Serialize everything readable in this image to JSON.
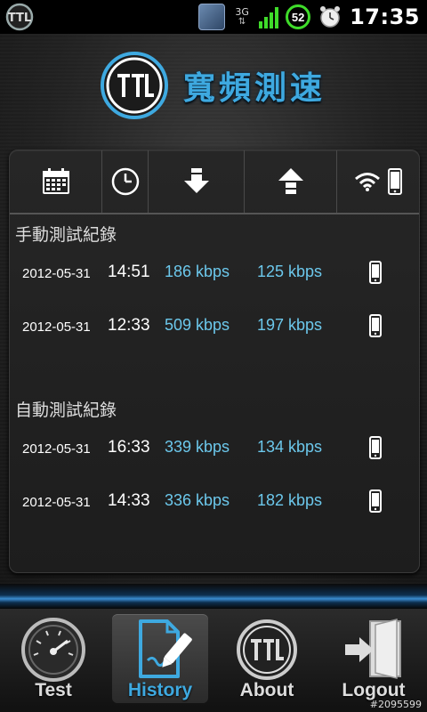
{
  "status_bar": {
    "network": "3G",
    "battery": "52",
    "time": "17:35"
  },
  "app": {
    "title": "寬頻測速"
  },
  "table_header": {
    "columns": [
      "calendar-icon",
      "clock-icon",
      "download-arrow-icon",
      "upload-arrow-icon",
      "connection-type-icons"
    ]
  },
  "manual_section": {
    "title": "手動測試紀錄",
    "rows": [
      {
        "date": "2012-05-31",
        "time": "14:51",
        "download": "186 kbps",
        "upload": "125 kbps",
        "device": "phone-icon"
      },
      {
        "date": "2012-05-31",
        "time": "12:33",
        "download": "509 kbps",
        "upload": "197 kbps",
        "device": "phone-icon"
      }
    ]
  },
  "auto_section": {
    "title": "自動測試紀錄",
    "rows": [
      {
        "date": "2012-05-31",
        "time": "16:33",
        "download": "339 kbps",
        "upload": "134 kbps",
        "device": "phone-icon"
      },
      {
        "date": "2012-05-31",
        "time": "14:33",
        "download": "336 kbps",
        "upload": "182 kbps",
        "device": "phone-icon"
      }
    ]
  },
  "tabs": [
    {
      "label": "Test",
      "icon": "speedometer-icon",
      "active": false
    },
    {
      "label": "History",
      "icon": "document-pen-icon",
      "active": true
    },
    {
      "label": "About",
      "icon": "ttl-logo-icon",
      "active": false
    },
    {
      "label": "Logout",
      "icon": "exit-door-icon",
      "active": false
    }
  ],
  "watermark": "#2095599",
  "colors": {
    "accent": "#3ea9e0",
    "speed_text": "#6cc8ec",
    "signal": "#3fdc2a"
  }
}
